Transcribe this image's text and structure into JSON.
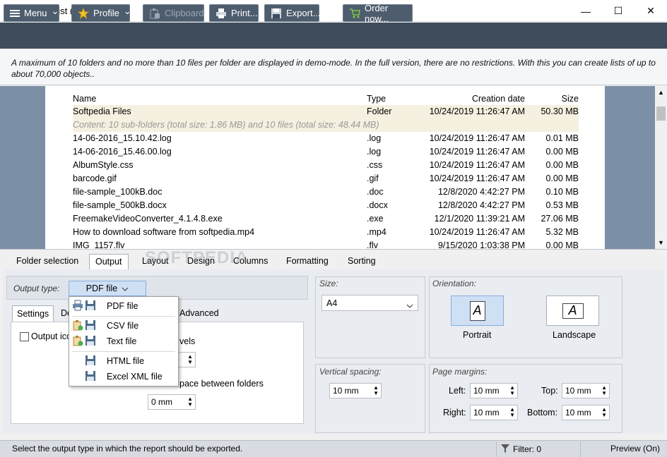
{
  "window": {
    "title": "Folder2List (Demo)",
    "minimize_glyph": "—",
    "maximize_glyph": "☐",
    "close_glyph": "✕"
  },
  "toolbar": {
    "menu": "Menu",
    "profile": "Profile",
    "clipboard": "Clipboard",
    "print": "Print...",
    "export": "Export...",
    "order": "Order now...",
    "chevron": "⌄"
  },
  "info_text": "A maximum of 10 folders and no more than 10 files per folder are displayed in demo-mode. In the full version, there are no restrictions. With this you can create lists of up to about 70,000 objects..",
  "list": {
    "headers": {
      "name": "Name",
      "type": "Type",
      "date": "Creation date",
      "size": "Size"
    },
    "folder": {
      "name": "Softpedia Files",
      "type": "Folder",
      "date": "10/24/2019 11:26:47 AM",
      "size": "50.30 MB"
    },
    "content_note": "Content: 10 sub-folders (total size: 1.86 MB) and 10 files (total size: 48.44 MB)",
    "rows": [
      {
        "name": "14-06-2016_15.10.42.log",
        "type": ".log",
        "date": "10/24/2019 11:26:47 AM",
        "size": "0.01 MB"
      },
      {
        "name": "14-06-2016_15.46.00.log",
        "type": ".log",
        "date": "10/24/2019 11:26:47 AM",
        "size": "0.00 MB"
      },
      {
        "name": "AlbumStyle.css",
        "type": ".css",
        "date": "10/24/2019 11:26:47 AM",
        "size": "0.00 MB"
      },
      {
        "name": "barcode.gif",
        "type": ".gif",
        "date": "10/24/2019 11:26:47 AM",
        "size": "0.00 MB"
      },
      {
        "name": "file-sample_100kB.doc",
        "type": ".doc",
        "date": "12/8/2020 4:42:27 PM",
        "size": "0.10 MB"
      },
      {
        "name": "file-sample_500kB.docx",
        "type": ".docx",
        "date": "12/8/2020 4:42:27 PM",
        "size": "0.53 MB"
      },
      {
        "name": "FreemakeVideoConverter_4.1.4.8.exe",
        "type": ".exe",
        "date": "12/1/2020 11:39:21 AM",
        "size": "27.06 MB"
      },
      {
        "name": "How to download software from softpedia.mp4",
        "type": ".mp4",
        "date": "10/24/2019 11:26:47 AM",
        "size": "5.32 MB"
      },
      {
        "name": "IMG_1157.flv",
        "type": ".flv",
        "date": "9/15/2020 1:03:38 PM",
        "size": "0.00 MB"
      }
    ]
  },
  "tabs": [
    "Folder selection",
    "Output",
    "Layout",
    "Design",
    "Columns",
    "Formatting",
    "Sorting"
  ],
  "output": {
    "type_label": "Output type:",
    "selected": "PDF file",
    "options": [
      "PDF file",
      "CSV file",
      "Text file",
      "HTML file",
      "Excel XML file"
    ]
  },
  "subtabs": {
    "settings": "Settings",
    "de": "De",
    "advanced": "Advanced"
  },
  "settings": {
    "output_icons_partial": "Output ico",
    "levels_partial": "vels",
    "space_between_folders_partial": "pace between folders",
    "spacing_value": "0 mm"
  },
  "size": {
    "label": "Size:",
    "value": "A4"
  },
  "orientation": {
    "label": "Orientation:",
    "portrait": "Portrait",
    "landscape": "Landscape",
    "glyph": "A"
  },
  "vertical_spacing": {
    "label": "Vertical spacing:",
    "value": "10 mm"
  },
  "margins": {
    "label": "Page margins:",
    "left_label": "Left:",
    "left": "10 mm",
    "top_label": "Top:",
    "top": "10 mm",
    "right_label": "Right:",
    "right": "10 mm",
    "bottom_label": "Bottom:",
    "bottom": "10 mm"
  },
  "status": {
    "message": "Select the output type in which the report should be exported.",
    "filter": "Filter: 0",
    "preview": "Preview (On)"
  },
  "watermark": "SOFTPEDIA",
  "colors": {
    "toolbar": "#3f4d5c",
    "preview_bg": "#7b8fa6",
    "highlight": "#f5f0df",
    "accent": "#cfe0f5"
  }
}
